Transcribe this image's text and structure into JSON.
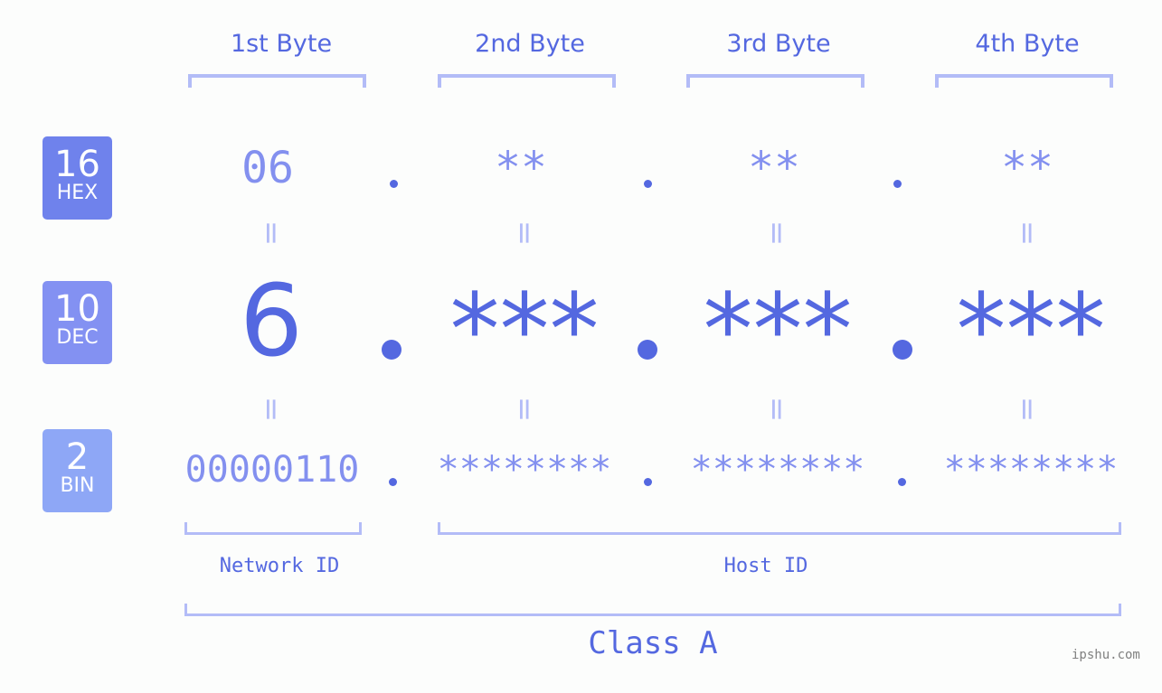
{
  "byte_headers": [
    "1st Byte",
    "2nd Byte",
    "3rd Byte",
    "4th Byte"
  ],
  "badges": [
    {
      "number": "16",
      "label": "HEX",
      "color": "#6f82ec"
    },
    {
      "number": "10",
      "label": "DEC",
      "color": "#8391f2"
    },
    {
      "number": "2",
      "label": "BIN",
      "color": "#8ea7f6"
    }
  ],
  "hex_values": [
    "06",
    "**",
    "**",
    "**"
  ],
  "dec_values": [
    "6",
    "***",
    "***",
    "***"
  ],
  "bin_values": [
    "00000110",
    "********",
    "********",
    "********"
  ],
  "equals_sign": "=",
  "network_id_label": "Network ID",
  "host_id_label": "Host ID",
  "class_label": "Class A",
  "watermark": "ipshu.com",
  "colors": {
    "accent": "#5468e0",
    "light": "#8390ef",
    "bracket": "#b3bcf7"
  }
}
